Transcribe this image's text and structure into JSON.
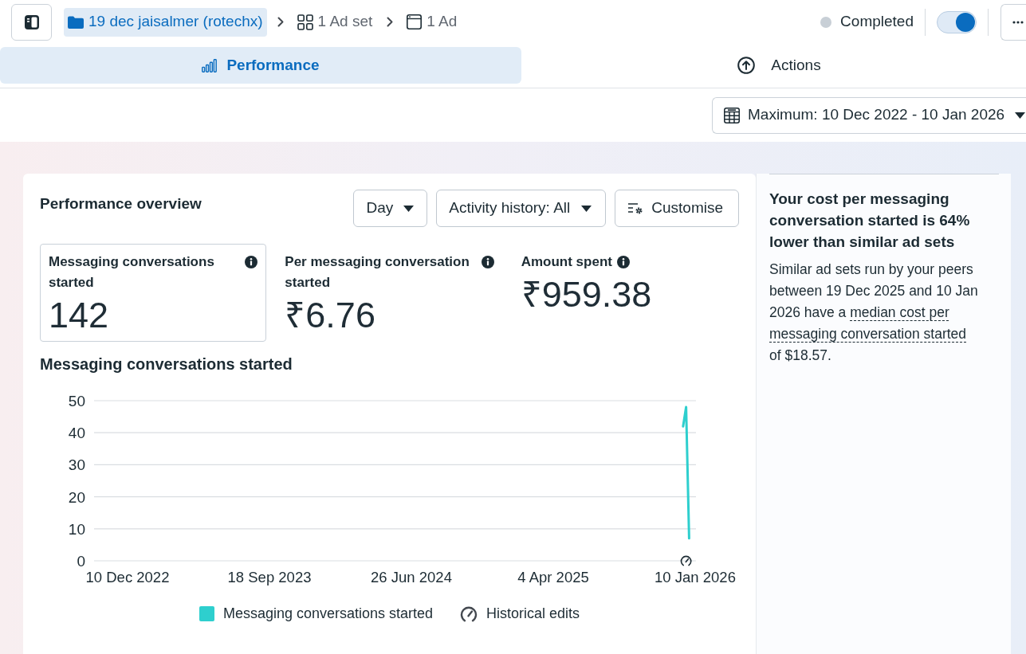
{
  "header": {
    "breadcrumb": [
      {
        "kind": "campaign",
        "label": "19 dec jaisalmer (rotechx)",
        "selected": true
      },
      {
        "kind": "adset",
        "label": "1 Ad set",
        "selected": false
      },
      {
        "kind": "ad",
        "label": "1 Ad",
        "selected": false
      }
    ],
    "status": "Completed",
    "toggle": {
      "on": true
    }
  },
  "tabs": [
    {
      "kind": "performance",
      "label": "Performance",
      "selected": true
    },
    {
      "kind": "actions",
      "label": "Actions",
      "selected": false
    }
  ],
  "date_range": {
    "label": "Maximum: 10 Dec 2022 - 10 Jan 2026"
  },
  "overview": {
    "title": "Performance overview",
    "controls": [
      {
        "kind": "dropdown",
        "label": "Day"
      },
      {
        "kind": "dropdown",
        "label": "Activity history: All"
      },
      {
        "kind": "customise",
        "label": "Customise"
      }
    ],
    "metrics": [
      {
        "label": "Messaging conversations started",
        "value": "142",
        "selected": true
      },
      {
        "label": "Per messaging conversation started",
        "value": "₹6.76",
        "selected": false
      },
      {
        "label": "Amount spent",
        "value": "₹959.38",
        "selected": false
      }
    ],
    "chart": {
      "chart_data": {
        "type": "line",
        "title": "Messaging conversations started",
        "grid": true,
        "categories": [
          "10 Dec 2022",
          null,
          null,
          null,
          null,
          null,
          null,
          null,
          null,
          null,
          null,
          null,
          null,
          null,
          null,
          null,
          null,
          null,
          null,
          null,
          null,
          null,
          null,
          null,
          null,
          null,
          null,
          null,
          null,
          null,
          null,
          null,
          null,
          null,
          null,
          null,
          null,
          null,
          null,
          null,
          null,
          null,
          null,
          null,
          null,
          null,
          null,
          "18 Sep 2023",
          null,
          null,
          null,
          null,
          null,
          null,
          null,
          null,
          null,
          null,
          null,
          null,
          null,
          null,
          null,
          null,
          null,
          null,
          null,
          null,
          null,
          null,
          null,
          null,
          null,
          null,
          null,
          null,
          null,
          null,
          null,
          null,
          null,
          null,
          null,
          null,
          null,
          null,
          null,
          null,
          null,
          null,
          null,
          null,
          null,
          null,
          "26 Jun 2024",
          null,
          null,
          null,
          null,
          null,
          null,
          null,
          null,
          null,
          null,
          null,
          null,
          null,
          null,
          null,
          null,
          null,
          null,
          null,
          null,
          null,
          null,
          null,
          null,
          null,
          null,
          null,
          null,
          null,
          null,
          null,
          null,
          null,
          null,
          null,
          null,
          null,
          null,
          null,
          null,
          null,
          null,
          null,
          null,
          null,
          null,
          "4 Apr 2025",
          null,
          null,
          null,
          null,
          null,
          null,
          null,
          null,
          null,
          null,
          null,
          null,
          null,
          null,
          null,
          null,
          null,
          null,
          null,
          null,
          null,
          null,
          null,
          null,
          null,
          null,
          null,
          null,
          null,
          null,
          null,
          null,
          null,
          null,
          null,
          null,
          null,
          null,
          null,
          null,
          null,
          null,
          null,
          null,
          null,
          null,
          "10 Jan 2026"
        ],
        "series": [
          {
            "name": "Messaging conversations started",
            "color": "#2ecfce",
            "values": [
              null,
              null,
              null,
              null,
              null,
              null,
              null,
              null,
              null,
              null,
              null,
              null,
              null,
              null,
              null,
              null,
              null,
              null,
              null,
              null,
              null,
              null,
              null,
              null,
              null,
              null,
              null,
              null,
              null,
              null,
              null,
              null,
              null,
              null,
              null,
              null,
              null,
              null,
              null,
              null,
              null,
              null,
              null,
              null,
              null,
              null,
              null,
              null,
              null,
              null,
              null,
              null,
              null,
              null,
              null,
              null,
              null,
              null,
              null,
              null,
              null,
              null,
              null,
              null,
              null,
              null,
              null,
              null,
              null,
              null,
              null,
              null,
              null,
              null,
              null,
              null,
              null,
              null,
              null,
              null,
              null,
              null,
              null,
              null,
              null,
              null,
              null,
              null,
              null,
              null,
              null,
              null,
              null,
              null,
              null,
              null,
              null,
              null,
              null,
              null,
              null,
              null,
              null,
              null,
              null,
              null,
              null,
              null,
              null,
              null,
              null,
              null,
              null,
              null,
              null,
              null,
              null,
              null,
              null,
              null,
              null,
              null,
              null,
              null,
              null,
              null,
              null,
              null,
              null,
              null,
              null,
              null,
              null,
              null,
              null,
              null,
              null,
              null,
              null,
              null,
              null,
              null,
              null,
              null,
              null,
              null,
              null,
              null,
              null,
              null,
              null,
              null,
              null,
              null,
              null,
              null,
              null,
              null,
              null,
              null,
              null,
              null,
              null,
              null,
              null,
              null,
              null,
              null,
              null,
              null,
              null,
              null,
              null,
              null,
              null,
              null,
              null,
              null,
              null,
              null,
              null,
              null,
              null,
              null,
              42,
              48,
              7,
              null,
              null
            ]
          }
        ],
        "ylim": [
          0,
          50
        ],
        "yticks": [
          0,
          10,
          20,
          30,
          40,
          50
        ]
      },
      "edits_label": "Historical edits"
    }
  },
  "insight": {
    "title": "Your cost per messaging conversation started is 64% lower than similar ad sets",
    "body_start": "Similar ad sets run by your peers between 19 Dec 2025 and 10 Jan 2026 have a",
    "term": "median cost per messaging conversation started",
    "body_end": "of $18.57."
  }
}
